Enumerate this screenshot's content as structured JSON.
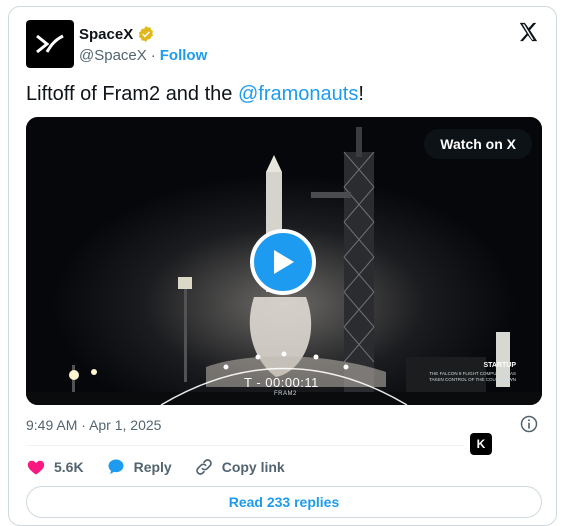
{
  "account": {
    "name": "SpaceX",
    "handle": "@SpaceX",
    "separator": "·",
    "follow_label": "Follow"
  },
  "tweet": {
    "text_prefix": "Liftoff of Fram2 and the ",
    "mention": "@framonauts",
    "text_suffix": "!"
  },
  "media": {
    "watch_label": "Watch on X",
    "countdown": "T - 00:00:11",
    "countdown_sub": "FRAM2",
    "startup_title": "STARTUP",
    "startup_desc": "The Falcon 9 flight computer has taken control of the countdown"
  },
  "meta": {
    "time": "9:49 AM",
    "separator": "·",
    "date": "Apr 1, 2025",
    "badge_letter": "K"
  },
  "actions": {
    "likes": "5.6K",
    "reply_label": "Reply",
    "copy_label": "Copy link"
  },
  "replies_label": "Read 233 replies",
  "icons": {
    "like": "heart-icon",
    "reply": "speech-bubble-icon",
    "copy": "link-icon",
    "info": "info-icon",
    "verified": "verified-badge-icon",
    "platform": "x-logo-icon"
  },
  "colors": {
    "accent": "#1d9bf0",
    "like": "#f91880",
    "verified": "#e2b719",
    "text": "#0f1419",
    "muted": "#536471"
  }
}
